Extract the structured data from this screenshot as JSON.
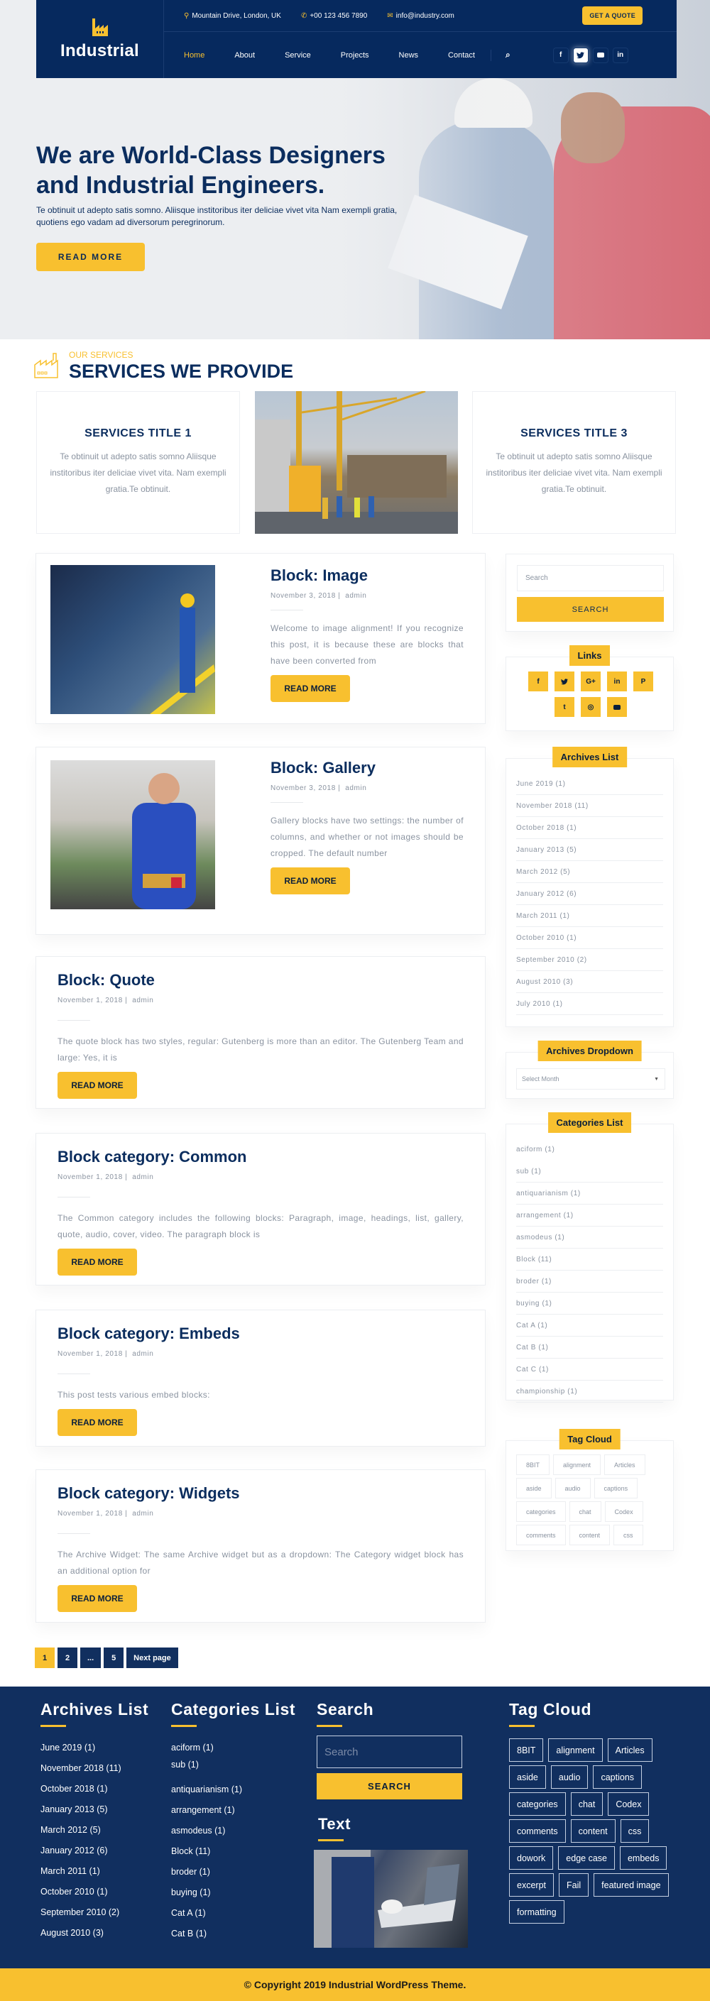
{
  "header": {
    "logo": "Industrial",
    "address": "Mountain Drive, London, UK",
    "phone": "+00 123 456 7890",
    "email": "info@industry.com",
    "quote_button": "GET A QUOTE",
    "nav": [
      "Home",
      "About",
      "Service",
      "Projects",
      "News",
      "Contact"
    ],
    "active_nav": "Home",
    "social": [
      {
        "icon": "facebook-icon",
        "glyph": "f",
        "active": false
      },
      {
        "icon": "twitter-icon",
        "glyph": "t",
        "active": true
      },
      {
        "icon": "youtube-icon",
        "glyph": "▶",
        "active": false
      },
      {
        "icon": "linkedin-icon",
        "glyph": "in",
        "active": false
      }
    ]
  },
  "hero": {
    "title": "We are World-Class Designers and Industrial Engineers.",
    "subtitle": "Te obtinuit ut adepto satis somno. Aliisque institoribus iter deliciae vivet vita Nam exempli gratia, quotiens ego vadam ad diversorum peregrinorum.",
    "button": "READ MORE"
  },
  "services": {
    "eyebrow": "OUR SERVICES",
    "title": "SERVICES WE PROVIDE",
    "cards": [
      {
        "title": "SERVICES TITLE 1",
        "text": "Te obtinuit ut adepto satis somno Aliisque institoribus iter deliciae vivet vita. Nam exempli gratia.Te obtinuit."
      },
      {
        "title": "SERVICES TITLE 3",
        "text": "Te obtinuit ut adepto satis somno Aliisque institoribus iter deliciae vivet vita. Nam exempli gratia.Te obtinuit."
      }
    ]
  },
  "posts": [
    {
      "title": "Block: Image",
      "date": "November 3, 2018",
      "author": "admin",
      "excerpt": "Welcome to image alignment! If you recognize this post, it is because these are blocks that have been converted from",
      "button": "READ MORE"
    },
    {
      "title": "Block: Gallery",
      "date": "November 3, 2018",
      "author": "admin",
      "excerpt": "Gallery blocks have two settings: the number of columns, and whether or not images should be cropped. The default number",
      "button": "READ MORE"
    },
    {
      "title": "Block: Quote",
      "date": "November 1, 2018",
      "author": "admin",
      "excerpt": "The quote block has two styles, regular: Gutenberg is more than an editor. The Gutenberg Team and large: Yes, it is",
      "button": "READ MORE"
    },
    {
      "title": "Block category: Common",
      "date": "November 1, 2018",
      "author": "admin",
      "excerpt": "The Common category includes the following blocks: Paragraph, image, headings, list, gallery, quote, audio, cover, video. The paragraph block is",
      "button": "READ MORE"
    },
    {
      "title": "Block category: Embeds",
      "date": "November 1, 2018",
      "author": "admin",
      "excerpt": "This post tests various embed blocks:",
      "button": "READ MORE"
    },
    {
      "title": "Block category: Widgets",
      "date": "November 1, 2018",
      "author": "admin",
      "excerpt": "The Archive Widget: The same Archive widget but as a dropdown: The Category widget block has an additional option for",
      "button": "READ MORE"
    }
  ],
  "pagination": [
    "1",
    "2",
    "...",
    "5",
    "Next page"
  ],
  "sidebar": {
    "search_placeholder": "Search",
    "search_button": "SEARCH",
    "links_title": "Links",
    "links": [
      {
        "icon": "facebook-icon",
        "glyph": "f"
      },
      {
        "icon": "twitter-icon",
        "glyph": "🐦"
      },
      {
        "icon": "google-plus-icon",
        "glyph": "G+"
      },
      {
        "icon": "linkedin-icon",
        "glyph": "in"
      },
      {
        "icon": "pinterest-icon",
        "glyph": "P"
      },
      {
        "icon": "tumblr-icon",
        "glyph": "t"
      },
      {
        "icon": "instagram-icon",
        "glyph": "◎"
      },
      {
        "icon": "youtube-icon",
        "glyph": "▶"
      }
    ],
    "archives_title": "Archives List",
    "archives": [
      "June 2019 (1)",
      "November 2018 (11)",
      "October 2018 (1)",
      "January 2013 (5)",
      "March 2012 (5)",
      "January 2012 (6)",
      "March 2011 (1)",
      "October 2010 (1)",
      "September 2010 (2)",
      "August 2010 (3)",
      "July 2010 (1)"
    ],
    "dropdown_title": "Archives Dropdown",
    "dropdown_value": "Select Month",
    "categories_title": "Categories List",
    "categories": [
      "aciform (1)",
      "sub (1)",
      "antiquarianism (1)",
      "arrangement (1)",
      "asmodeus (1)",
      "Block (11)",
      "broder (1)",
      "buying (1)",
      "Cat A (1)",
      "Cat B (1)",
      "Cat C (1)",
      "championship (1)"
    ],
    "tag_title": "Tag Cloud",
    "tags": [
      "8BIT",
      "alignment",
      "Articles",
      "aside",
      "audio",
      "captions",
      "categories",
      "chat",
      "Codex",
      "comments",
      "content",
      "css"
    ]
  },
  "footer": {
    "archives_title": "Archives List",
    "archives": [
      "June 2019 (1)",
      "November 2018 (11)",
      "October 2018 (1)",
      "January 2013 (5)",
      "March 2012 (5)",
      "January 2012 (6)",
      "March 2011 (1)",
      "October 2010 (1)",
      "September 2010 (2)",
      "August 2010 (3)"
    ],
    "categories_title": "Categories List",
    "categories": [
      "aciform (1)",
      "sub (1)",
      "antiquarianism (1)",
      "arrangement (1)",
      "asmodeus (1)",
      "Block (11)",
      "broder (1)",
      "buying (1)",
      "Cat A (1)",
      "Cat B (1)"
    ],
    "search_title": "Search",
    "search_placeholder": "Search",
    "search_button": "SEARCH",
    "text_title": "Text",
    "tag_title": "Tag Cloud",
    "tags": [
      "8BIT",
      "alignment",
      "Articles",
      "aside",
      "audio",
      "captions",
      "categories",
      "chat",
      "Codex",
      "comments",
      "content",
      "css",
      "dowork",
      "edge case",
      "embeds",
      "excerpt",
      "Fail",
      "featured image",
      "formatting"
    ],
    "copyright": "© Copyright 2019 Industrial WordPress Theme."
  },
  "colors": {
    "navy": "#06295e",
    "footer_navy": "#112f5f",
    "accent_yellow": "#f8c02f",
    "muted_text": "#8a93a0"
  }
}
